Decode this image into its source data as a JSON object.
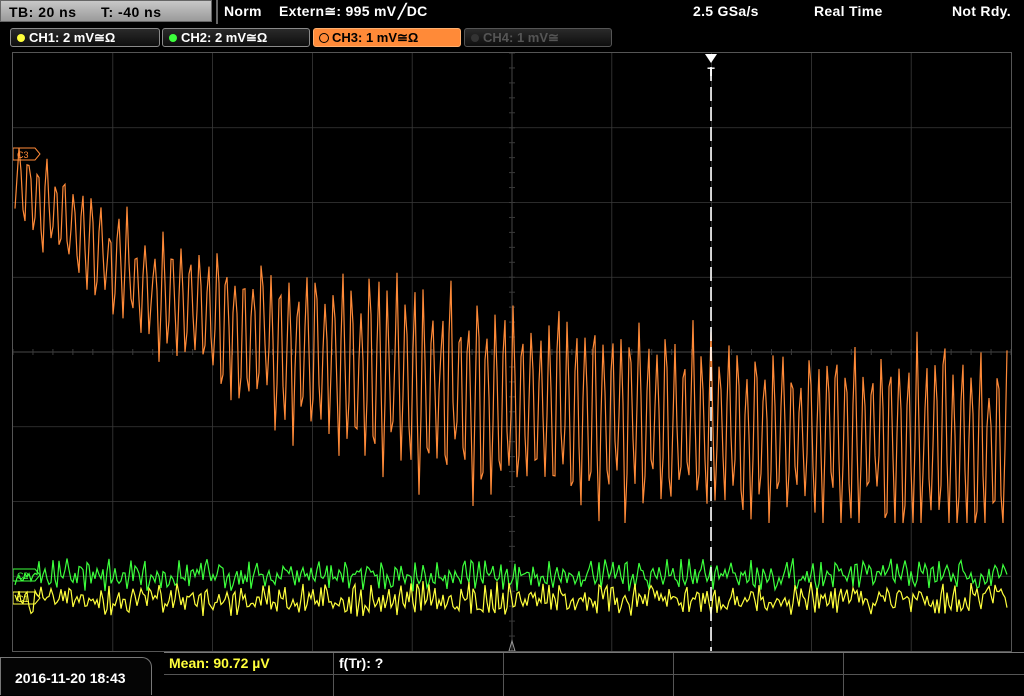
{
  "top": {
    "timebase": "TB: 20 ns",
    "trigger_time": "T: -40 ns",
    "trigger_mode": "Norm",
    "trigger_source": "Extern≅: 995 mV",
    "trigger_slope": "╱DC",
    "sample_rate": "2.5 GSa/s",
    "acq_mode": "Real Time",
    "status": "Not Rdy."
  },
  "channels": [
    {
      "label": "CH1: 2 mV≅Ω",
      "color": "#ffff3c",
      "state": "on"
    },
    {
      "label": "CH2: 2 mV≅Ω",
      "color": "#3cff3c",
      "state": "on"
    },
    {
      "label": "CH3: 1 mV≅Ω",
      "color": "#ff8a38",
      "state": "active"
    },
    {
      "label": "CH4: 1 mV≅",
      "color": "#555555",
      "state": "off"
    }
  ],
  "markers": {
    "ch3": "C3",
    "ch2": "C2",
    "ch1": "C1",
    "trigger": "T"
  },
  "bottom": {
    "datetime": "2016-11-20 18:43",
    "mean_label": "Mean: 90.72 µV",
    "freq_label": "f(Tr): ?"
  },
  "colors": {
    "ch1": "#ffff3c",
    "ch2": "#3cff3c",
    "ch3": "#ff8a38",
    "grid": "#3a3a3a",
    "mean_text": "#ffff3c"
  }
}
